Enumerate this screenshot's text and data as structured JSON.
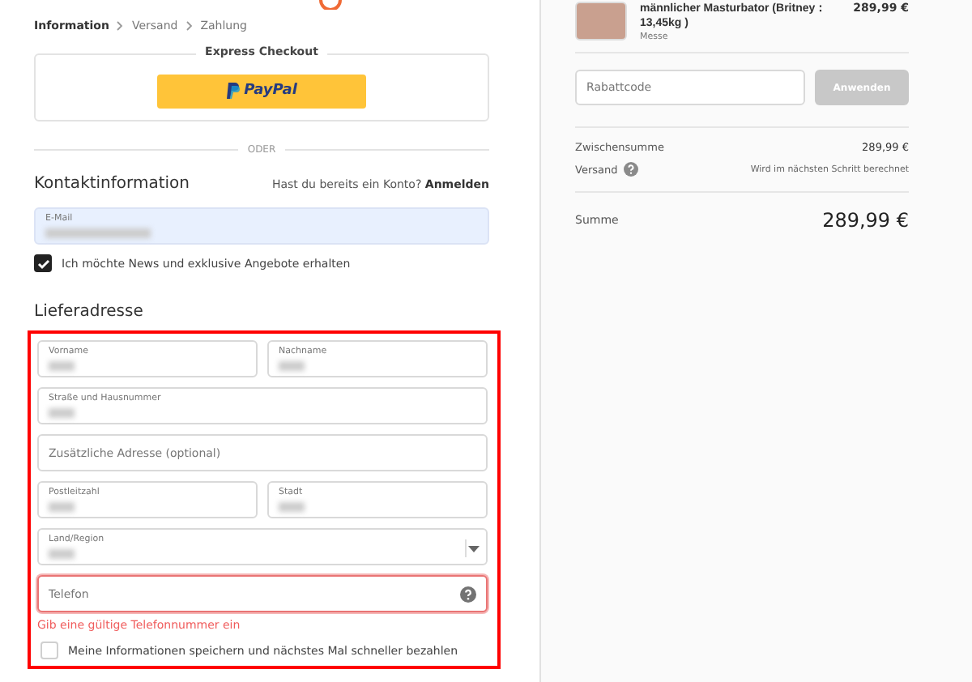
{
  "breadcrumb": [
    {
      "label": "Information",
      "selected": true
    },
    {
      "label": "Versand",
      "selected": false
    },
    {
      "label": "Zahlung",
      "selected": false
    }
  ],
  "express_checkout": {
    "title": "Express Checkout",
    "button": "PayPal"
  },
  "divider_label": "ODER",
  "contact": {
    "heading": "Kontaktinformation",
    "account_prompt": "Hast du bereits ein Konto?",
    "login_link": "Anmelden",
    "email": {
      "label": "E-Mail",
      "redacted": true
    },
    "newsletter": {
      "label": "Ich möchte News und exklusive Angebote erhalten",
      "checked": true
    }
  },
  "shipping": {
    "heading": "Lieferadresse",
    "highlighted": true,
    "rows": [
      [
        {
          "label": "Vorname",
          "redacted": true
        },
        {
          "label": "Nachname",
          "redacted": true
        }
      ],
      [
        {
          "label": "Straße und Hausnummer",
          "redacted": true
        }
      ],
      [
        {
          "placeholder": "Zusätzliche Adresse (optional)"
        }
      ],
      [
        {
          "label": "Postleitzahl",
          "redacted": true
        },
        {
          "label": "Stadt",
          "redacted": true
        }
      ],
      [
        {
          "label": "Land/Region",
          "redacted": true,
          "kind": "select"
        }
      ],
      [
        {
          "placeholder": "Telefon",
          "kind": "phone",
          "invalid": true
        }
      ]
    ],
    "error": "Gib eine gültige Telefonnummer ein",
    "remember": {
      "label": "Meine Informationen speichern und nächstes Mal schneller bezahlen",
      "checked": false
    }
  },
  "summary": {
    "product": {
      "name": "männlicher Masturbator (Britney：",
      "name_line_2": "13,45kg )",
      "variant": "Messe",
      "price": "289,99 €"
    },
    "discount": {
      "placeholder": "Rabattcode",
      "button": "Anwenden",
      "disabled": true
    },
    "lines": [
      {
        "label": "Zwischensumme",
        "value": "289,99 €",
        "help": false
      },
      {
        "label": "Versand",
        "value": "Wird im nächsten Schritt berechnet",
        "help": true
      }
    ],
    "total": {
      "label": "Summe",
      "value": "289,99 €"
    }
  }
}
